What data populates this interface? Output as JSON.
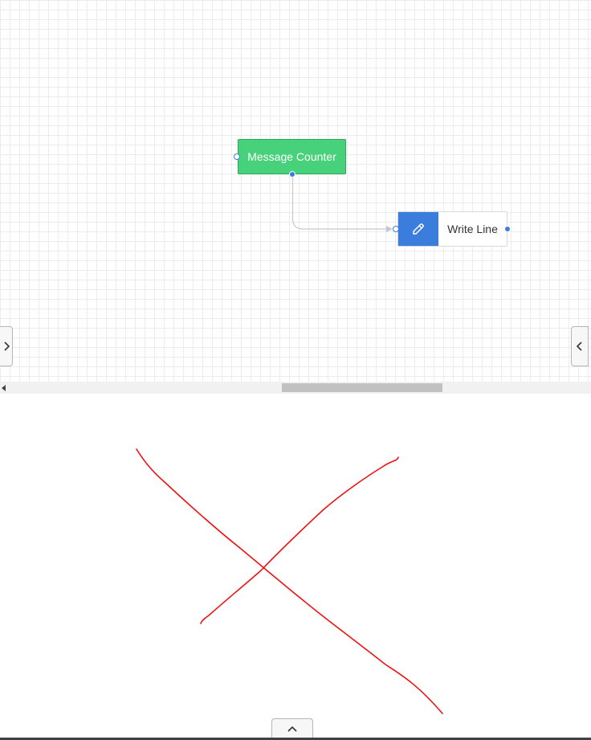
{
  "designer": {
    "nodes": {
      "message_counter": {
        "label": "Message Counter",
        "color": "#48d17b"
      },
      "write_line": {
        "label": "Write Line",
        "icon": "pencil-icon",
        "accent": "#3b7ddd"
      }
    },
    "connection_color": "#c4c9d1"
  },
  "controls": {
    "left_toggle_icon": "chevron-right-icon",
    "right_toggle_icon": "chevron-left-icon",
    "bottom_toggle_icon": "chevron-up-icon",
    "scroll_left_icon": "triangle-left-icon"
  },
  "annotation": {
    "color": "#ff0000",
    "shape": "red-x-mark"
  }
}
